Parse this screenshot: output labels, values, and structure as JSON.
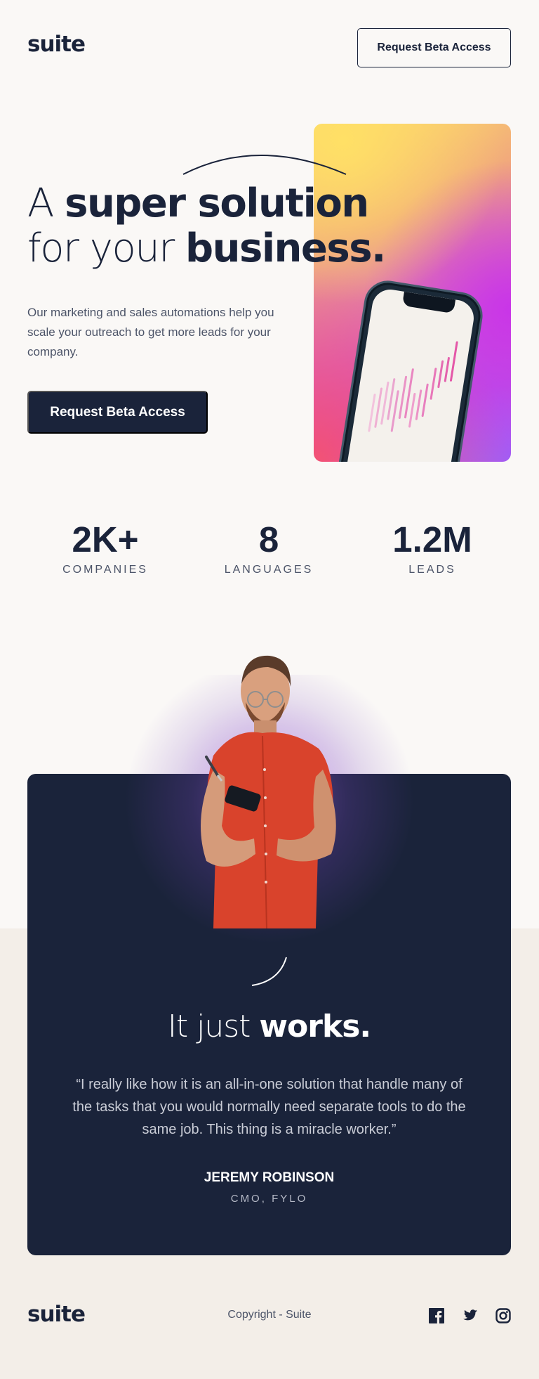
{
  "header": {
    "logo": "suite",
    "cta_label": "Request Beta Access"
  },
  "hero": {
    "title_light_1": "A ",
    "title_bold_1": "super solution",
    "title_light_2": "for your ",
    "title_bold_2": "business.",
    "description": "Our marketing and sales automations help you scale your outreach to get more leads for your company.",
    "cta_label": "Request Beta Access"
  },
  "stats": [
    {
      "value": "2K+",
      "label": "COMPANIES"
    },
    {
      "value": "8",
      "label": "LANGUAGES"
    },
    {
      "value": "1.2M",
      "label": "LEADS"
    }
  ],
  "testimonial": {
    "title_light": "It just ",
    "title_bold": "works.",
    "quote": "“I really like how it is an all-in-one solution that handle many of the tasks that you would normally need separate tools to do the same job. This thing is a miracle worker.”",
    "author_name": "JEREMY ROBINSON",
    "author_role": "CMO, FYLO"
  },
  "footer": {
    "logo": "suite",
    "copyright": "Copyright - Suite",
    "social_icons": [
      "facebook-icon",
      "twitter-icon",
      "instagram-icon"
    ]
  },
  "colors": {
    "navy": "#1a233a",
    "background": "#faf8f6",
    "background_bottom": "#f3eee8",
    "accent_gradient": [
      "#ffe066",
      "#f35273",
      "#c935e8",
      "#a35cf3"
    ]
  }
}
